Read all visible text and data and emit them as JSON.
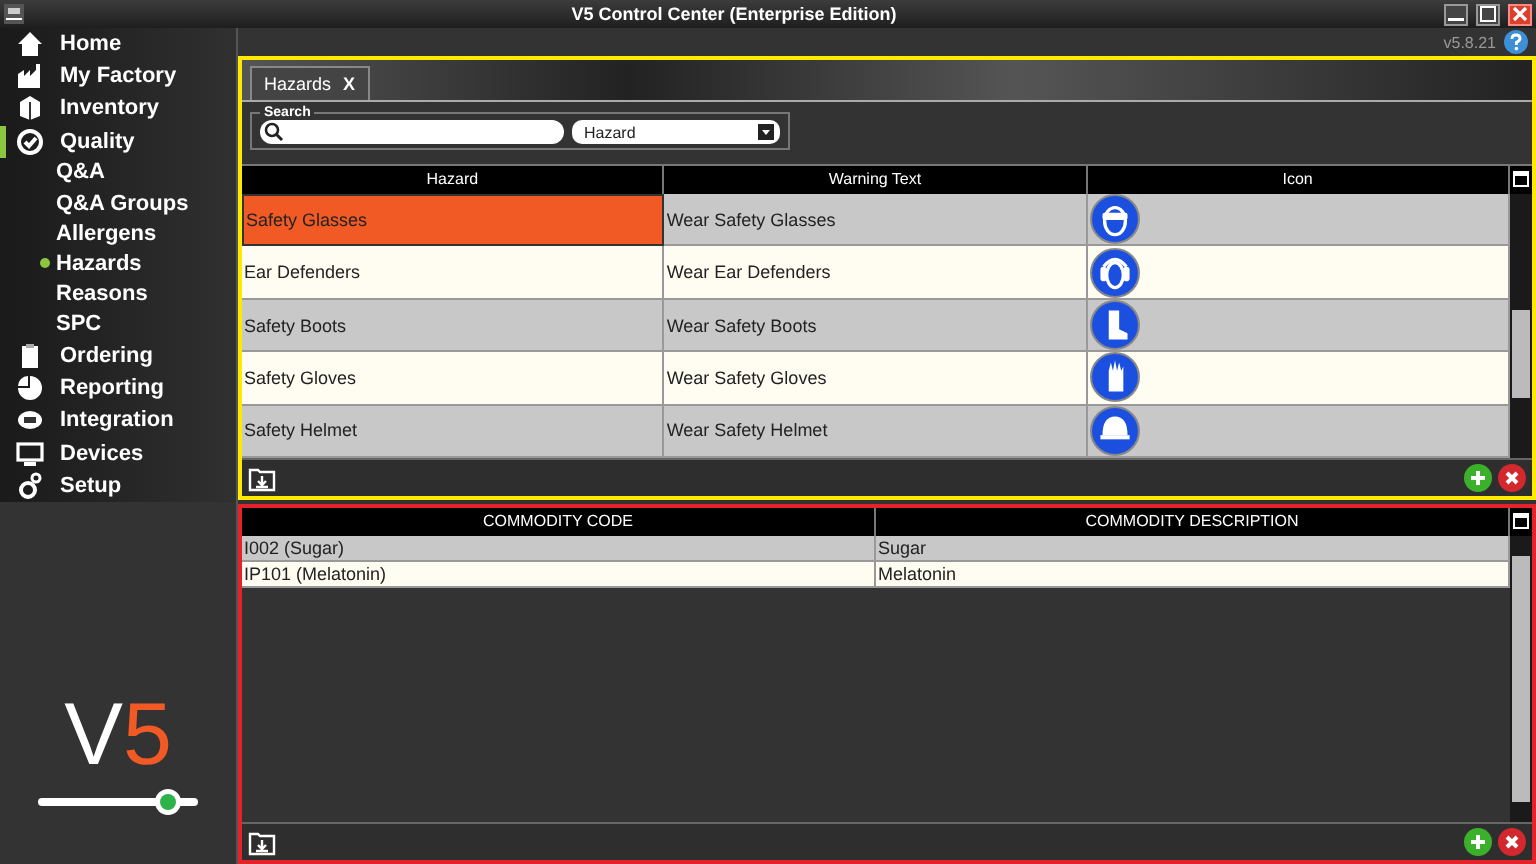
{
  "window": {
    "title": "V5 Control Center (Enterprise Edition)",
    "version": "v5.8.21"
  },
  "sidebar": {
    "items": [
      {
        "label": "Home",
        "expanded": false
      },
      {
        "label": "My Factory",
        "expanded": false
      },
      {
        "label": "Inventory",
        "expanded": false
      },
      {
        "label": "Quality",
        "expanded": true,
        "children": [
          {
            "label": "Q&A",
            "selected": false
          },
          {
            "label": "Q&A Groups",
            "selected": false
          },
          {
            "label": "Allergens",
            "selected": false
          },
          {
            "label": "Hazards",
            "selected": true
          },
          {
            "label": "Reasons",
            "selected": false
          },
          {
            "label": "SPC",
            "selected": false
          }
        ]
      },
      {
        "label": "Ordering",
        "expanded": false
      },
      {
        "label": "Reporting",
        "expanded": false
      },
      {
        "label": "Integration",
        "expanded": false
      },
      {
        "label": "Devices",
        "expanded": false
      },
      {
        "label": "Setup",
        "expanded": false
      }
    ],
    "logo": {
      "letter": "V",
      "digit": "5"
    }
  },
  "tabs": [
    {
      "label": "Hazards",
      "close": "X",
      "selected": true
    }
  ],
  "search": {
    "legend": "Search",
    "filter": "Hazard"
  },
  "hazard_table": {
    "columns": [
      "Hazard",
      "Warning Text",
      "Icon"
    ],
    "rows": [
      {
        "hazard": "Safety Glasses",
        "warning": "Wear Safety Glasses",
        "selected": true
      },
      {
        "hazard": "Ear Defenders",
        "warning": "Wear Ear Defenders",
        "selected": false
      },
      {
        "hazard": "Safety Boots",
        "warning": "Wear Safety Boots",
        "selected": false
      },
      {
        "hazard": "Safety Gloves",
        "warning": "Wear Safety Gloves",
        "selected": false
      },
      {
        "hazard": "Safety Helmet",
        "warning": "Wear Safety Helmet",
        "selected": false
      }
    ]
  },
  "commodity_table": {
    "columns": [
      "COMMODITY CODE",
      "COMMODITY DESCRIPTION"
    ],
    "rows": [
      {
        "code": "I002 (Sugar)",
        "description": "Sugar"
      },
      {
        "code": "IP101 (Melatonin)",
        "description": "Melatonin"
      }
    ]
  }
}
